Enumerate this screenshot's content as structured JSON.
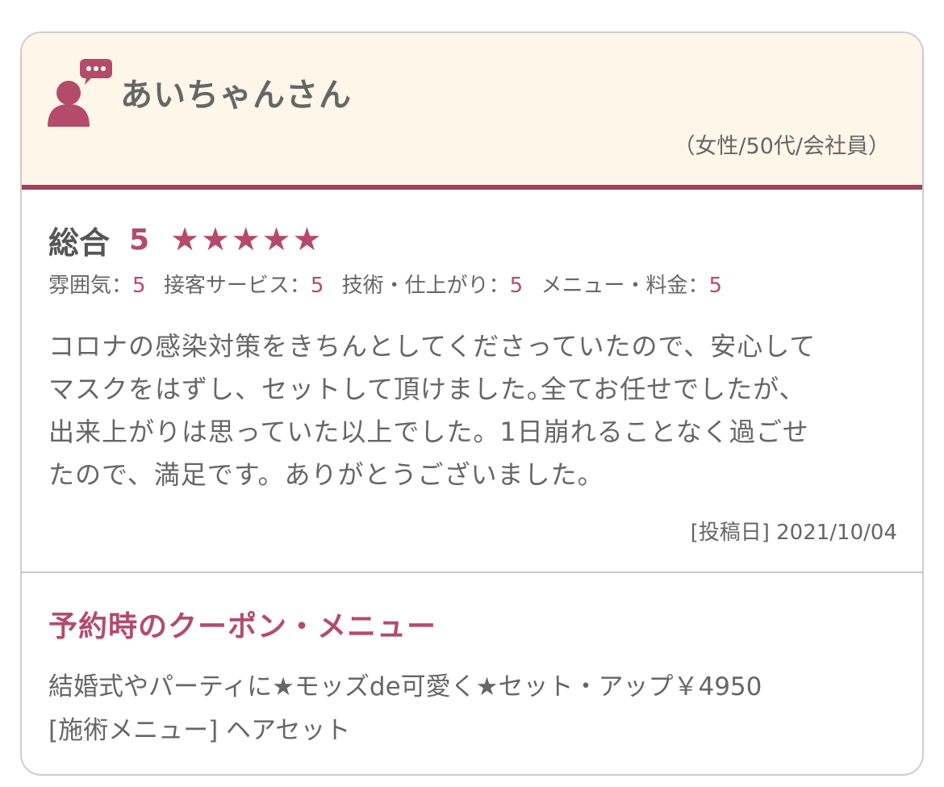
{
  "reviewer": {
    "name": "あいちゃんさん",
    "meta": "（女性/50代/会社員）",
    "icon": "user-comment-icon"
  },
  "rating": {
    "overall_label": "総合",
    "overall_score": "5",
    "stars": 5,
    "star_glyph": "★",
    "accent_color": "#b44b6b",
    "sub_ratings": [
      {
        "label": "雰囲気：",
        "value": "5"
      },
      {
        "label": "接客サービス：",
        "value": "5"
      },
      {
        "label": "技術・仕上がり：",
        "value": "5"
      },
      {
        "label": "メニュー・料金：",
        "value": "5"
      }
    ]
  },
  "comment": {
    "lines": [
      "コロナの感染対策をきちんとしてくださっていたので、安心して",
      "マスクをはずし、セットして頂けました｡全てお任せでしたが、",
      "出来上がりは思っていた以上でした。1日崩れることなく過ごせ",
      "たので、満足です。ありがとうございました。"
    ]
  },
  "post": {
    "date_text": "[投稿日] 2021/10/04"
  },
  "coupon": {
    "title": "予約時のクーポン・メニュー",
    "name": "結婚式やパーティに★モッズde可愛く★セット・アップ￥4950",
    "menu_line": "[施術メニュー] ヘアセット"
  }
}
